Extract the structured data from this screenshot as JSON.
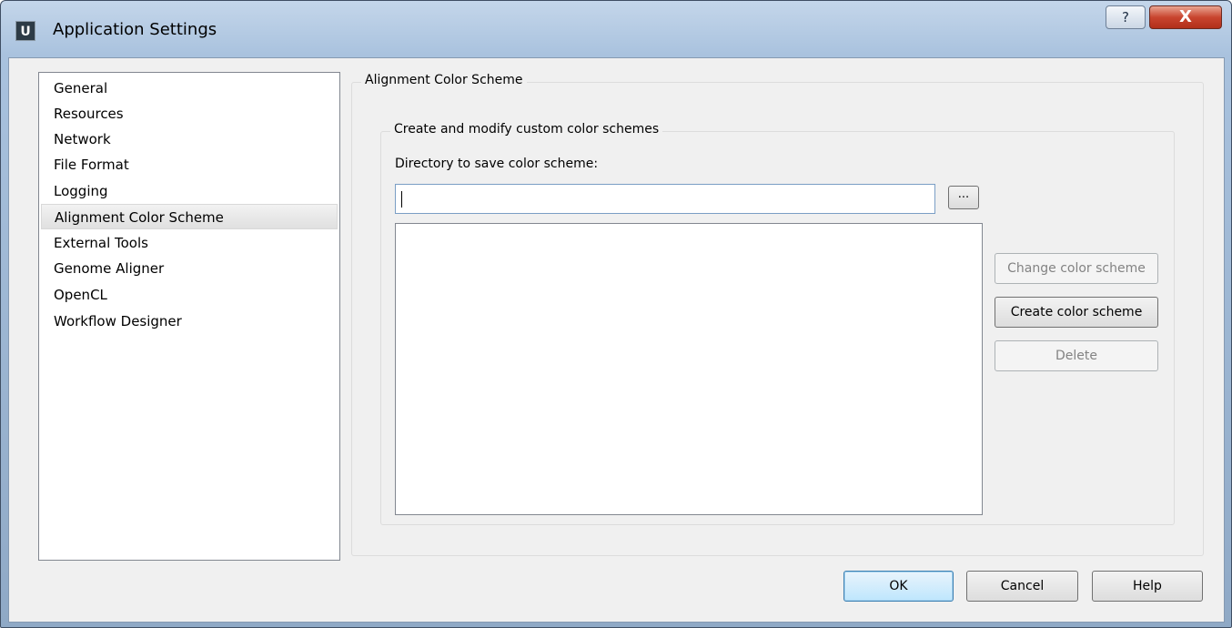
{
  "window": {
    "title": "Application Settings",
    "icon_letter": "U",
    "help_glyph": "?",
    "close_glyph": "X"
  },
  "nav": {
    "items": [
      {
        "label": "General"
      },
      {
        "label": "Resources"
      },
      {
        "label": "Network"
      },
      {
        "label": "File Format"
      },
      {
        "label": "Logging"
      },
      {
        "label": "Alignment Color Scheme",
        "selected": true
      },
      {
        "label": "External Tools"
      },
      {
        "label": "Genome Aligner"
      },
      {
        "label": "OpenCL"
      },
      {
        "label": "Workflow Designer"
      }
    ]
  },
  "panel": {
    "group_title": "Alignment Color Scheme",
    "custom": {
      "group_title": "Create and modify custom color schemes",
      "dir_label": "Directory to save color scheme:",
      "dir_value": "",
      "browse_label": "...",
      "change_label": "Change color scheme",
      "create_label": "Create color scheme",
      "delete_label": "Delete"
    }
  },
  "buttons": {
    "ok": "OK",
    "cancel": "Cancel",
    "help": "Help"
  }
}
